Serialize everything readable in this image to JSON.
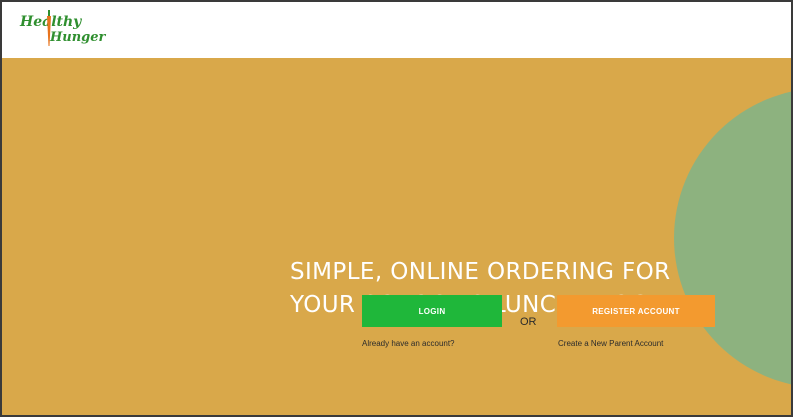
{
  "brand": {
    "logo_line1": "Healthy",
    "logo_line2": "Hunger"
  },
  "hero": {
    "headline_line1": "SIMPLE, ONLINE ORDERING FOR",
    "headline_line2": "YOUR SCHOOL’S LUNCH PROGRAM"
  },
  "actions": {
    "login_label": "LOGIN",
    "login_caption": "Already have an account?",
    "or_label": "OR",
    "register_label": "REGISTER ACCOUNT",
    "register_caption": "Create a New Parent Account"
  },
  "colors": {
    "hero_background": "#d9a84a",
    "accent_circle": "#8db27f",
    "login_button": "#1fb73a",
    "register_button": "#f39a2f",
    "logo_green": "#2f8f2f",
    "carrot_orange": "#e8731c"
  },
  "icons": {
    "logo_mark": "carrot-icon"
  }
}
